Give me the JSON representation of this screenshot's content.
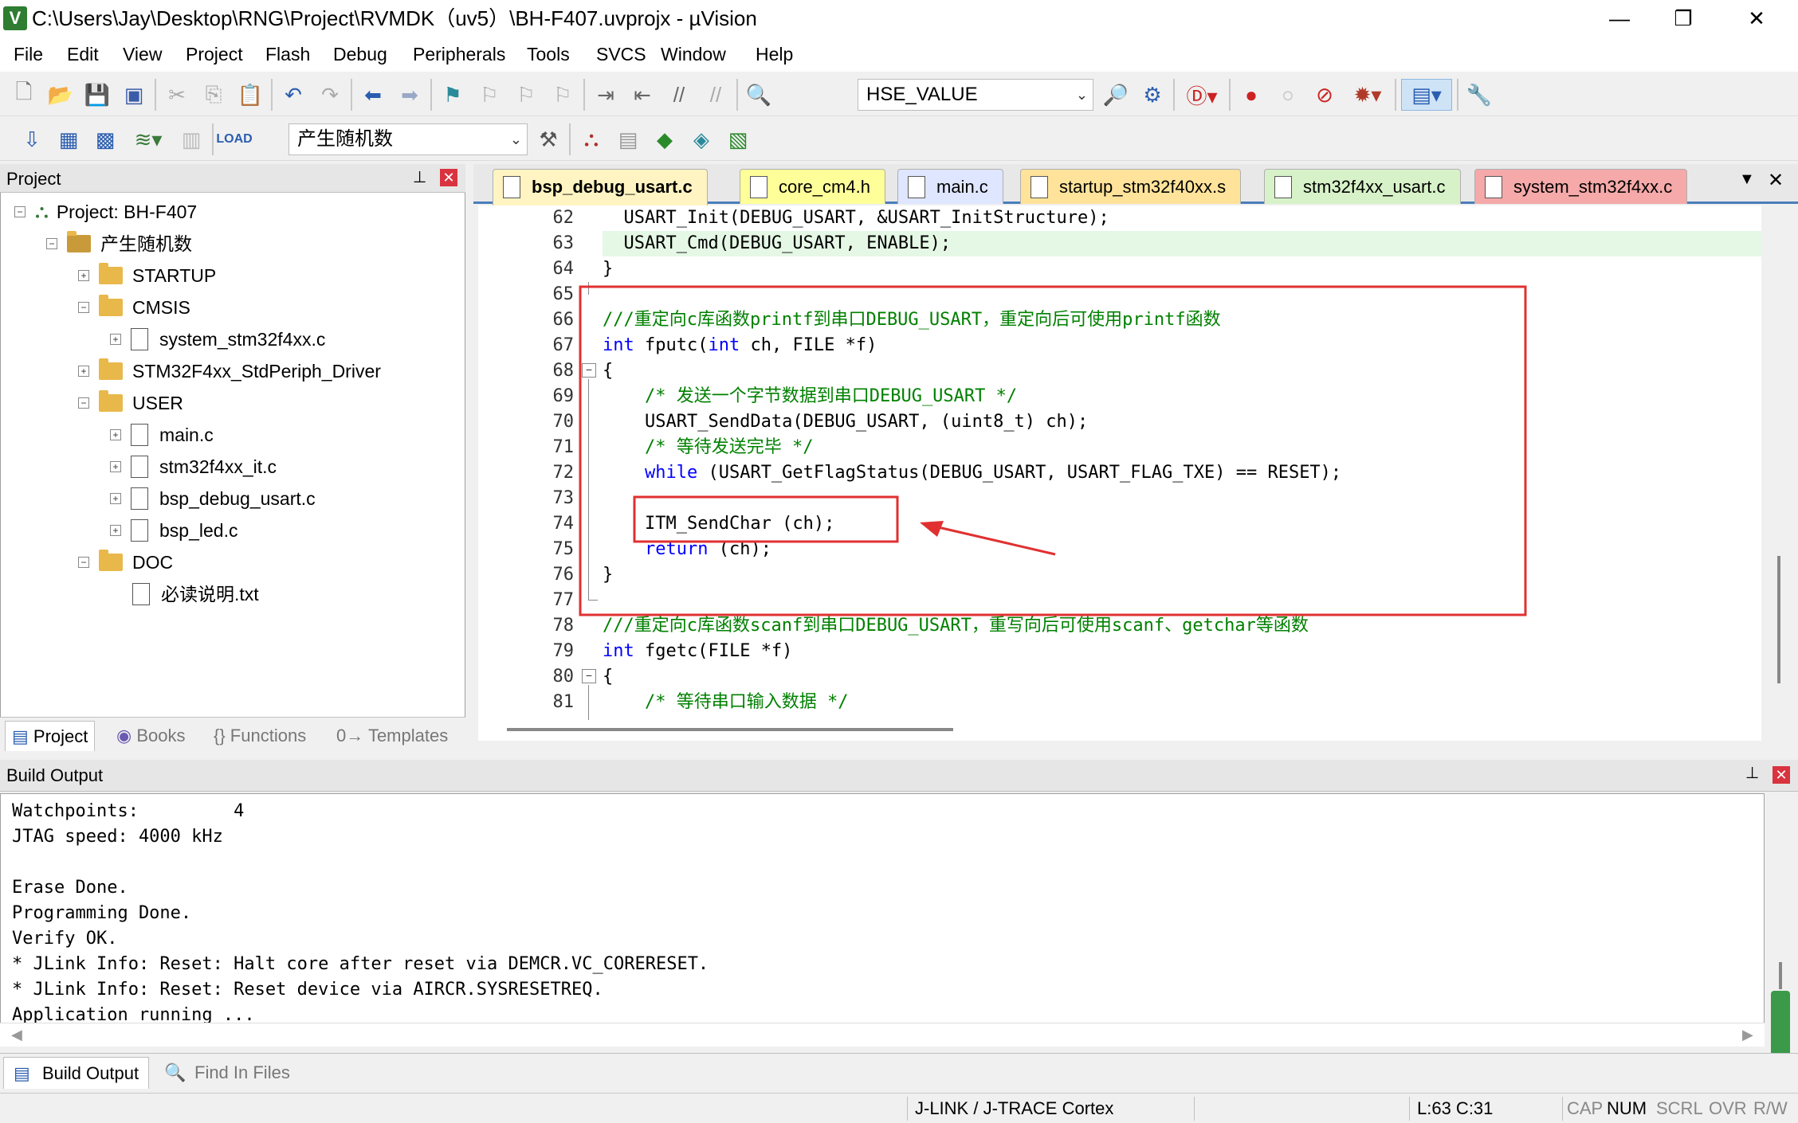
{
  "window": {
    "title": "C:\\Users\\Jay\\Desktop\\RNG\\Project\\RVMDK（uv5）\\BH-F407.uvprojx - µVision",
    "icon_letter": "V",
    "minimize": "—",
    "maximize": "❐",
    "close": "✕"
  },
  "menu": [
    "File",
    "Edit",
    "View",
    "Project",
    "Flash",
    "Debug",
    "Peripherals",
    "Tools",
    "SVCS",
    "Window",
    "Help"
  ],
  "toolbar1": {
    "find_combo_value": "HSE_VALUE"
  },
  "toolbar2": {
    "target_combo_value": "产生随机数"
  },
  "project_panel": {
    "title": "Project",
    "pin": "⊥",
    "close": "✕",
    "tree": [
      {
        "label": "Project: BH-F407",
        "level": 0,
        "type": "project",
        "expander": "−"
      },
      {
        "label": "产生随机数",
        "level": 1,
        "type": "target",
        "expander": "−"
      },
      {
        "label": "STARTUP",
        "level": 2,
        "type": "folder",
        "expander": "+"
      },
      {
        "label": "CMSIS",
        "level": 2,
        "type": "folder",
        "expander": "−"
      },
      {
        "label": "system_stm32f4xx.c",
        "level": 3,
        "type": "file",
        "expander": "+"
      },
      {
        "label": "STM32F4xx_StdPeriph_Driver",
        "level": 2,
        "type": "folder",
        "expander": "+"
      },
      {
        "label": "USER",
        "level": 2,
        "type": "folder",
        "expander": "−"
      },
      {
        "label": "main.c",
        "level": 3,
        "type": "file",
        "expander": "+"
      },
      {
        "label": "stm32f4xx_it.c",
        "level": 3,
        "type": "file",
        "expander": "+"
      },
      {
        "label": "bsp_debug_usart.c",
        "level": 3,
        "type": "file",
        "expander": "+"
      },
      {
        "label": "bsp_led.c",
        "level": 3,
        "type": "file",
        "expander": "+"
      },
      {
        "label": "DOC",
        "level": 2,
        "type": "folder",
        "expander": "−"
      },
      {
        "label": "必读说明.txt",
        "level": 3,
        "type": "file",
        "expander": ""
      }
    ],
    "tabs": [
      "Project",
      "Books",
      "{} Functions",
      "0→ Templates"
    ]
  },
  "editor": {
    "tabs": [
      {
        "label": "bsp_debug_usart.c",
        "color": "#fff4c2",
        "active": true
      },
      {
        "label": "core_cm4.h",
        "color": "#ffff99"
      },
      {
        "label": "main.c",
        "color": "#dfe6ff"
      },
      {
        "label": "startup_stm32f40xx.s",
        "color": "#ffe39a"
      },
      {
        "label": "stm32f4xx_usart.c",
        "color": "#d7f2c8"
      },
      {
        "label": "system_stm32f4xx.c",
        "color": "#f5a9a9"
      }
    ],
    "tab_menu": "▼",
    "tab_close": "✕",
    "lines": [
      {
        "n": "62",
        "text": "  USART_Init(DEBUG_USART, &USART_InitStructure);"
      },
      {
        "n": "63",
        "text": "  USART_Cmd(DEBUG_USART, ENABLE);"
      },
      {
        "n": "64",
        "text": "}"
      },
      {
        "n": "65",
        "text": ""
      },
      {
        "n": "66",
        "text": "///重定向c库函数printf到串口DEBUG_USART，重定向后可使用printf函数"
      },
      {
        "n": "67",
        "text": "int fputc(int ch, FILE *f)"
      },
      {
        "n": "68",
        "text": "{"
      },
      {
        "n": "69",
        "text": "    /* 发送一个字节数据到串口DEBUG_USART */"
      },
      {
        "n": "70",
        "text": "    USART_SendData(DEBUG_USART, (uint8_t) ch);"
      },
      {
        "n": "71",
        "text": "    /* 等待发送完毕 */"
      },
      {
        "n": "72",
        "text": "    while (USART_GetFlagStatus(DEBUG_USART, USART_FLAG_TXE) == RESET);"
      },
      {
        "n": "73",
        "text": ""
      },
      {
        "n": "74",
        "text": "    ITM_SendChar (ch);"
      },
      {
        "n": "75",
        "text": "    return (ch);"
      },
      {
        "n": "76",
        "text": "}"
      },
      {
        "n": "77",
        "text": ""
      },
      {
        "n": "78",
        "text": "///重定向c库函数scanf到串口DEBUG_USART，重写向后可使用scanf、getchar等函数"
      },
      {
        "n": "79",
        "text": "int fgetc(FILE *f)"
      },
      {
        "n": "80",
        "text": "{"
      },
      {
        "n": "81",
        "text": "    /* 等待串口输入数据 */"
      }
    ]
  },
  "build_output": {
    "title": "Build Output",
    "lines": [
      "Watchpoints:         4",
      "JTAG speed: 4000 kHz",
      "",
      "Erase Done.",
      "Programming Done.",
      "Verify OK.",
      "* JLink Info: Reset: Halt core after reset via DEMCR.VC_CORERESET.",
      "* JLink Info: Reset: Reset device via AIRCR.SYSRESETREQ.",
      "Application running ..."
    ],
    "tabs": [
      "Build Output",
      "Find In Files"
    ]
  },
  "status": {
    "debugger": "J-LINK / J-TRACE Cortex",
    "position": "L:63 C:31",
    "cap": "CAP",
    "num": "NUM",
    "scrl": "SCRL",
    "ovr": "OVR",
    "rw": "R/W"
  },
  "colors": {
    "annotation_red": "#e03030",
    "keyword": "#0000ff",
    "comment": "#008000"
  }
}
